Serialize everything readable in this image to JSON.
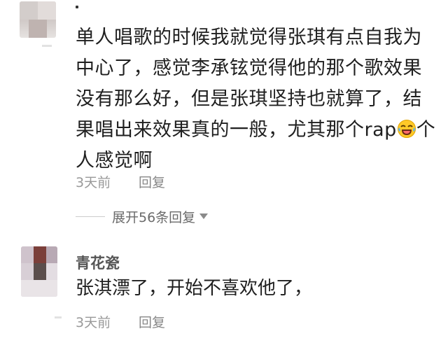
{
  "comment1": {
    "text_before_emoji": "单人唱歌的时候我就觉得张琪有点自我为中心了，感觉李承铉觉得他的那个歌效果没有那么好，但是张琪坚持也就算了，结果唱出来效果真的一般，尤其那个rap",
    "emoji": "laugh-cry-emoji",
    "text_after_emoji": "个人感觉啊",
    "time": "3天前",
    "reply_label": "回复"
  },
  "expand": {
    "label": "展开56条回复"
  },
  "comment2": {
    "username": "青花瓷",
    "text": "张淇漂了，开始不喜欢他了，",
    "time": "3天前",
    "reply_label": "回复"
  },
  "colors": {
    "text": "#1f1f1f",
    "meta": "#999999",
    "username": "#555555"
  }
}
